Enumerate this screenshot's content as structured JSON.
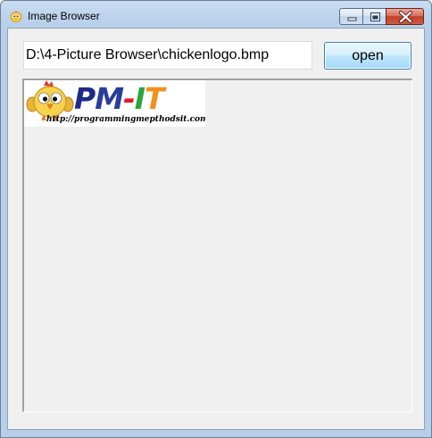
{
  "window": {
    "title": "Image Browser",
    "icon": "chick-icon",
    "controls": [
      "minimize-icon",
      "maximize-icon",
      "close-icon"
    ]
  },
  "toolbar": {
    "path_value": "D:\\4-Picture Browser\\chickenlogo.bmp",
    "open_label": "open"
  },
  "viewer": {
    "image": {
      "logo_text": "PM-IT",
      "url_text": "http://programmingmepthodsit.com",
      "mascot_icon": "chick-mascot-icon"
    }
  },
  "colors": {
    "title_bar": "#b8cfe9",
    "client_bg": "#f0f0f0",
    "button_bg": "#bee6fd",
    "close_button": "#c1402a",
    "logo_blue": "#1d2a8a",
    "logo_red": "#e41b23",
    "logo_green": "#2ca53a",
    "logo_orange": "#f2911f"
  }
}
